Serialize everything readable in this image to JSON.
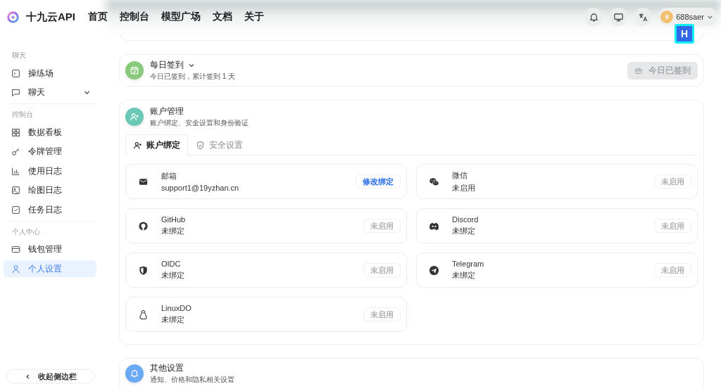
{
  "header": {
    "brand": "十九云API",
    "nav": [
      {
        "label": "首页"
      },
      {
        "label": "控制台"
      },
      {
        "label": "模型广场"
      },
      {
        "label": "文档"
      },
      {
        "label": "关于"
      }
    ],
    "user": {
      "avatar": "6",
      "name": "688saer"
    },
    "overlay_badge": "H"
  },
  "sidebar": {
    "groups": [
      {
        "label": "聊天",
        "items": [
          {
            "label": "操练场",
            "selected": false
          },
          {
            "label": "聊天",
            "selected": false,
            "expandable": true
          }
        ]
      },
      {
        "label": "控制台",
        "items": [
          {
            "label": "数据看板",
            "selected": false
          },
          {
            "label": "令牌管理",
            "selected": false
          },
          {
            "label": "使用日志",
            "selected": false
          },
          {
            "label": "绘图日志",
            "selected": false
          },
          {
            "label": "任务日志",
            "selected": false
          }
        ]
      },
      {
        "label": "个人中心",
        "items": [
          {
            "label": "钱包管理",
            "selected": false
          },
          {
            "label": "个人设置",
            "selected": true
          }
        ]
      }
    ],
    "collapse_button": "收起侧边栏"
  },
  "checkin": {
    "title": "每日签到",
    "subtitle": "今日已签到，累计签到 1 天",
    "button": "今日已签到",
    "disabled": true
  },
  "account": {
    "title": "账户管理",
    "subtitle": "账户绑定、安全设置和身份验证",
    "tabs": [
      {
        "label": "账户绑定",
        "selected": true
      },
      {
        "label": "安全设置",
        "selected": false
      }
    ],
    "bindings": [
      {
        "name": "邮箱",
        "status": "support1@19yzhan.cn",
        "button": "修改绑定",
        "disabled": false
      },
      {
        "name": "微信",
        "status": "未启用",
        "button": "未启用",
        "disabled": true
      },
      {
        "name": "GitHub",
        "status": "未绑定",
        "button": "未启用",
        "disabled": true
      },
      {
        "name": "Discord",
        "status": "未绑定",
        "button": "未启用",
        "disabled": true
      },
      {
        "name": "OIDC",
        "status": "未绑定",
        "button": "未启用",
        "disabled": true
      },
      {
        "name": "Telegram",
        "status": "未绑定",
        "button": "未启用",
        "disabled": true
      },
      {
        "name": "LinuxDO",
        "status": "未绑定",
        "button": "未启用",
        "disabled": true
      }
    ]
  },
  "other": {
    "title": "其他设置",
    "subtitle": "通知、价格和隐私相关设置"
  }
}
